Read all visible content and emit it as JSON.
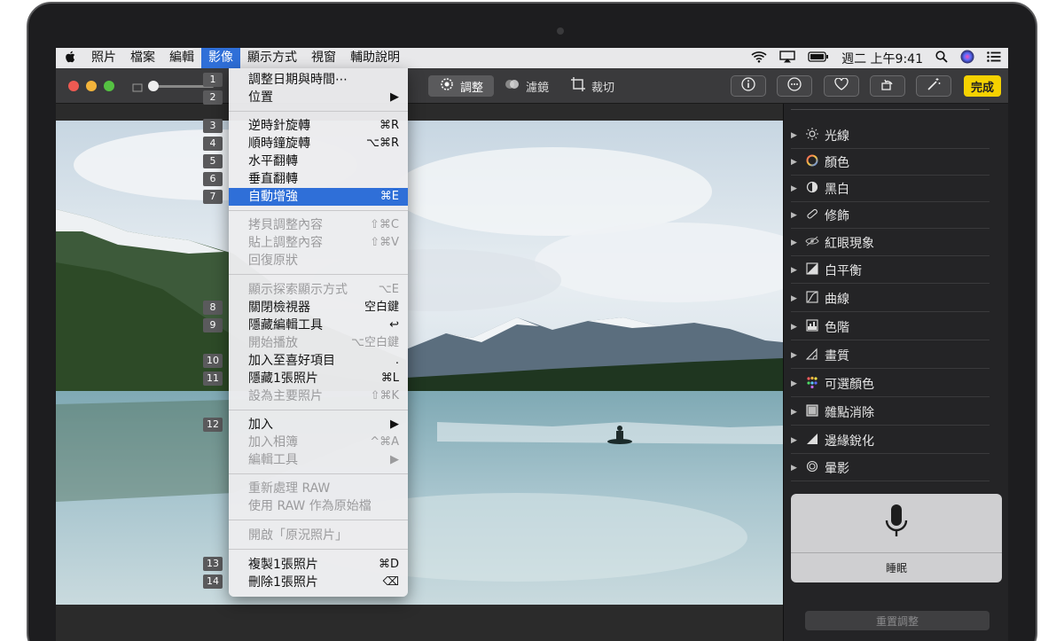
{
  "menubar": {
    "apple": "",
    "items": [
      "照片",
      "檔案",
      "編輯",
      "影像",
      "顯示方式",
      "視窗",
      "輔助說明"
    ],
    "active_index": 3,
    "clock": "週二 上午9:41"
  },
  "toolbar": {
    "tabs": [
      {
        "label": "調整"
      },
      {
        "label": "濾鏡"
      },
      {
        "label": "裁切"
      }
    ],
    "selected_tab": 0,
    "done_label": "完成"
  },
  "menu": {
    "items": [
      {
        "label": "調整日期與時間⋯",
        "shortcut": "",
        "disabled": false
      },
      {
        "label": "位置",
        "shortcut": "▶",
        "disabled": false
      },
      {
        "label": "逆時針旋轉",
        "shortcut": "⌘R",
        "disabled": false
      },
      {
        "label": "順時鐘旋轉",
        "shortcut": "⌥⌘R",
        "disabled": false
      },
      {
        "label": "水平翻轉",
        "shortcut": "",
        "disabled": false
      },
      {
        "label": "垂直翻轉",
        "shortcut": "",
        "disabled": false
      },
      {
        "label": "自動增強",
        "shortcut": "⌘E",
        "disabled": false,
        "highlighted": true
      },
      {
        "label": "拷貝調整內容",
        "shortcut": "⇧⌘C",
        "disabled": true
      },
      {
        "label": "貼上調整內容",
        "shortcut": "⇧⌘V",
        "disabled": true
      },
      {
        "label": "回復原狀",
        "shortcut": "",
        "disabled": true
      },
      {
        "label": "顯示探索顯示方式",
        "shortcut": "⌥E",
        "disabled": true
      },
      {
        "label": "關閉檢視器",
        "shortcut": "空白鍵",
        "disabled": false
      },
      {
        "label": "隱藏編輯工具",
        "shortcut": "↩",
        "disabled": false
      },
      {
        "label": "開始播放",
        "shortcut": "⌥空白鍵",
        "disabled": true
      },
      {
        "label": "加入至喜好項目",
        "shortcut": ".",
        "disabled": false
      },
      {
        "label": "隱藏1張照片",
        "shortcut": "⌘L",
        "disabled": false
      },
      {
        "label": "設為主要照片",
        "shortcut": "⇧⌘K",
        "disabled": true
      },
      {
        "label": "加入",
        "shortcut": "▶",
        "disabled": false
      },
      {
        "label": "加入相簿",
        "shortcut": "^⌘A",
        "disabled": true
      },
      {
        "label": "編輯工具",
        "shortcut": "▶",
        "disabled": true
      },
      {
        "label": "重新處理 RAW",
        "shortcut": "",
        "disabled": true
      },
      {
        "label": "使用 RAW 作為原始檔",
        "shortcut": "",
        "disabled": true
      },
      {
        "label": "開啟「原況照片」",
        "shortcut": "",
        "disabled": true
      },
      {
        "label": "複製1張照片",
        "shortcut": "⌘D",
        "disabled": false
      },
      {
        "label": "刪除1張照片",
        "shortcut": "⌫",
        "disabled": false
      }
    ],
    "badges": [
      "1",
      "2",
      "3",
      "4",
      "5",
      "6",
      "7",
      "8",
      "9",
      "10",
      "11",
      "12",
      "13",
      "14"
    ]
  },
  "panel": {
    "adjustments": [
      {
        "label": "光線",
        "icon": "sun-icon"
      },
      {
        "label": "顏色",
        "icon": "color-ring-icon"
      },
      {
        "label": "黑白",
        "icon": "half-circle-icon"
      },
      {
        "label": "修飾",
        "icon": "bandage-icon"
      },
      {
        "label": "紅眼現象",
        "icon": "eye-icon"
      },
      {
        "label": "白平衡",
        "icon": "white-balance-icon"
      },
      {
        "label": "曲線",
        "icon": "curves-icon"
      },
      {
        "label": "色階",
        "icon": "levels-icon"
      },
      {
        "label": "畫質",
        "icon": "definition-icon"
      },
      {
        "label": "可選顏色",
        "icon": "dots-icon"
      },
      {
        "label": "雜點消除",
        "icon": "noise-icon"
      },
      {
        "label": "邊緣銳化",
        "icon": "sharpen-icon"
      },
      {
        "label": "暈影",
        "icon": "vignette-icon"
      }
    ],
    "voice_label": "睡眠",
    "reset_label": "重置調整"
  }
}
